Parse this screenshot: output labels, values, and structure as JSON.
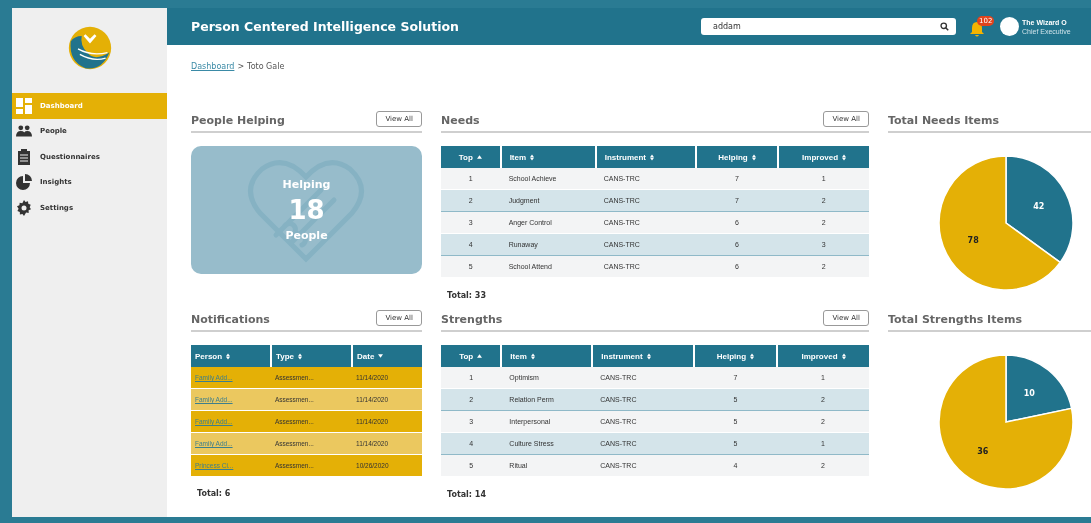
{
  "sidebar": {
    "items": [
      {
        "label": "Dashboard",
        "selected": true
      },
      {
        "label": "People",
        "selected": false
      },
      {
        "label": "Questionnaires",
        "selected": false
      },
      {
        "label": "Insights",
        "selected": false
      },
      {
        "label": "Settings",
        "selected": false
      }
    ]
  },
  "header": {
    "title": "Person Centered Intelligence Solution",
    "search": {
      "value": "addam"
    },
    "notification_count": "102",
    "user": {
      "name": "The Wizard O",
      "role": "Chief Executive"
    }
  },
  "breadcrumb": {
    "link": "Dashboard",
    "separator": ">",
    "current": "Toto Gale"
  },
  "people_helping": {
    "title": "People Helping",
    "button": "View All",
    "label_top": "Helping",
    "count": "18",
    "label_bottom": "People"
  },
  "needs": {
    "title": "Needs",
    "button": "View All",
    "columns": [
      {
        "label": "Top",
        "sorted": true,
        "descending": false
      },
      {
        "label": "Item",
        "sorted": false
      },
      {
        "label": "Instrument",
        "sorted": false
      },
      {
        "label": "Helping",
        "sorted": false
      },
      {
        "label": "Improved",
        "sorted": false
      }
    ],
    "rows": [
      [
        "1",
        "School Achieve",
        "CANS-TRC",
        "7",
        "1"
      ],
      [
        "2",
        "Judgment",
        "CANS-TRC",
        "7",
        "2"
      ],
      [
        "3",
        "Anger Control",
        "CANS-TRC",
        "6",
        "2"
      ],
      [
        "4",
        "Runaway",
        "CANS-TRC",
        "6",
        "3"
      ],
      [
        "5",
        "School Attend",
        "CANS-TRC",
        "6",
        "2"
      ]
    ],
    "total": "Total: 33"
  },
  "total_needs_items": {
    "title": "Total Needs Items",
    "chart_data": {
      "type": "pie",
      "values": [
        42,
        78
      ],
      "data_labels": true
    }
  },
  "notifications": {
    "title": "Notifications",
    "button": "View All",
    "columns": [
      {
        "label": "Person",
        "sorted": false
      },
      {
        "label": "Type",
        "sorted": false
      },
      {
        "label": "Date",
        "sorted": true,
        "descending": true
      }
    ],
    "rows": [
      [
        "Family Add...",
        "Assessmen...",
        "11/14/2020"
      ],
      [
        "Family Add...",
        "Assessmen...",
        "11/14/2020"
      ],
      [
        "Family Add...",
        "Assessmen...",
        "11/14/2020"
      ],
      [
        "Family Add...",
        "Assessmen...",
        "11/14/2020"
      ],
      [
        "Princess Ci...",
        "Assessmen...",
        "10/26/2020"
      ]
    ],
    "total": "Total: 6"
  },
  "strengths": {
    "title": "Strengths",
    "button": "View All",
    "columns": [
      {
        "label": "Top",
        "sorted": true,
        "descending": false
      },
      {
        "label": "Item",
        "sorted": false
      },
      {
        "label": "Instrument",
        "sorted": false
      },
      {
        "label": "Helping",
        "sorted": false
      },
      {
        "label": "Improved",
        "sorted": false
      }
    ],
    "rows": [
      [
        "1",
        "Optimism",
        "CANS-TRC",
        "7",
        "1"
      ],
      [
        "2",
        "Relation Perm",
        "CANS-TRC",
        "5",
        "2"
      ],
      [
        "3",
        "Interpersonal",
        "CANS-TRC",
        "5",
        "2"
      ],
      [
        "4",
        "Culture Stress",
        "CANS-TRC",
        "5",
        "1"
      ],
      [
        "5",
        "Ritual",
        "CANS-TRC",
        "4",
        "2"
      ]
    ],
    "total": "Total: 14"
  },
  "total_strengths_items": {
    "title": "Total Strengths Items",
    "chart_data": {
      "type": "pie",
      "values": [
        10,
        36
      ],
      "data_labels": true
    }
  }
}
